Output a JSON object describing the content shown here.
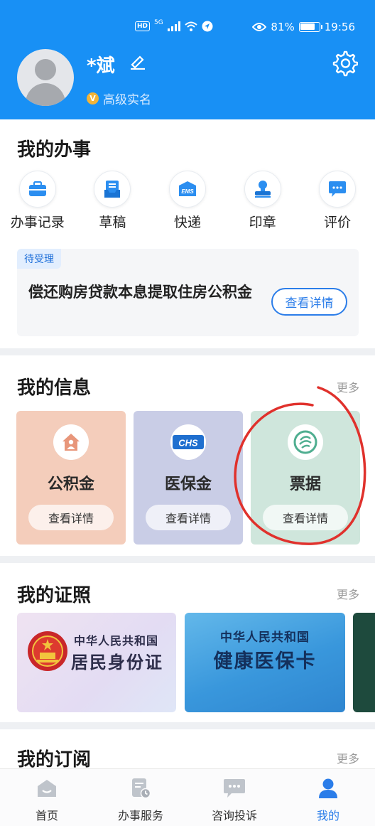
{
  "status_bar": {
    "network": "5G",
    "hd": "HD",
    "battery": "81%",
    "battery_level": 0.81,
    "time": "19:56"
  },
  "profile": {
    "username": "*斌",
    "badge_letter": "V",
    "verification": "高级实名"
  },
  "my_affairs": {
    "title": "我的办事",
    "items": [
      {
        "label": "办事记录",
        "icon": "briefcase-icon"
      },
      {
        "label": "草稿",
        "icon": "draft-icon"
      },
      {
        "label": "快递",
        "icon": "ems-icon",
        "icon_text": "EMS"
      },
      {
        "label": "印章",
        "icon": "stamp-icon"
      },
      {
        "label": "评价",
        "icon": "comment-icon"
      }
    ],
    "pending": {
      "tag": "待受理",
      "title": "偿还购房贷款本息提取住房公积金",
      "button": "查看详情"
    }
  },
  "my_info": {
    "title": "我的信息",
    "more": "更多",
    "tiles": [
      {
        "label": "公积金",
        "button": "查看详情",
        "icon": "house-person-icon",
        "bg": "#f4cdbb"
      },
      {
        "label": "医保金",
        "button": "查看详情",
        "icon": "chs-logo-icon",
        "icon_text": "CHS",
        "bg": "#c9cde6"
      },
      {
        "label": "票据",
        "button": "查看详情",
        "icon": "invoice-logo-icon",
        "bg": "#cfe6dc"
      }
    ]
  },
  "my_certificates": {
    "title": "我的证照",
    "more": "更多",
    "cards": [
      {
        "country": "中华人民共和国",
        "name": "居民身份证",
        "icon": "national-emblem-icon"
      },
      {
        "country": "中华人民共和国",
        "name": "健康医保卡"
      }
    ]
  },
  "my_subscriptions": {
    "title": "我的订阅",
    "more": "更多"
  },
  "bottom_nav": [
    {
      "label": "首页",
      "icon": "home-icon",
      "active": false
    },
    {
      "label": "办事服务",
      "icon": "service-icon",
      "active": false
    },
    {
      "label": "咨询投诉",
      "icon": "chat-icon",
      "active": false
    },
    {
      "label": "我的",
      "icon": "person-icon",
      "active": true
    }
  ],
  "colors": {
    "header_blue": "#1890f5",
    "accent_blue": "#2b7de9",
    "annotation_red": "#e0312c"
  }
}
